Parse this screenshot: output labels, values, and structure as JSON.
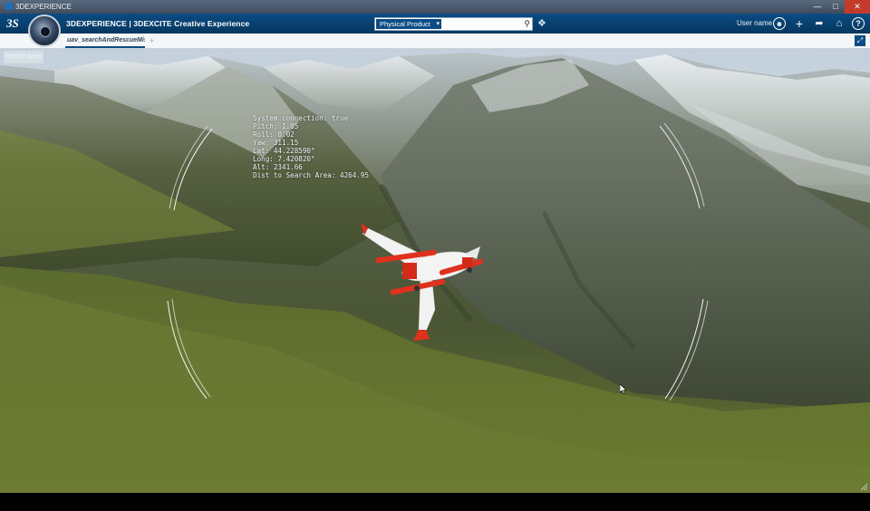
{
  "window": {
    "title": "3DEXPERIENCE"
  },
  "header": {
    "brand": "3DEXPERIENCE | 3DEXCITE Creative Experience",
    "search": {
      "scope": "Physical Product",
      "placeholder": ""
    },
    "user_name": "User name"
  },
  "tabs": [
    {
      "label": "uav_searchAndRescueMissi"
    }
  ],
  "viewport": {
    "search_area_button": "Search Area",
    "telemetry": {
      "line1": "System connection: true",
      "line2": "Pitch: 1.05",
      "line3": "Roll: 0.02",
      "line4": "Yaw: 311.15",
      "line5": "Lat: 44.228590°",
      "line6": "Long: 7.420820°",
      "line7": "Alt: 2341.66",
      "line8": "Dist to Search Area: 4264.95"
    }
  },
  "icons": {
    "logo": "3ds-logo-icon",
    "compass": "compass-icon",
    "search": "search-icon",
    "tag": "tag-icon",
    "avatar": "user-avatar-icon",
    "add": "plus-icon",
    "share": "share-icon",
    "home": "home-icon",
    "help": "help-icon",
    "fullscreen": "fullscreen-icon"
  },
  "colors": {
    "header_blue": "#05375f",
    "accent_blue": "#0a4c83",
    "hud_text": "#eef3f7",
    "uav_red": "#e0301e",
    "uav_white": "#f2f2f2"
  }
}
